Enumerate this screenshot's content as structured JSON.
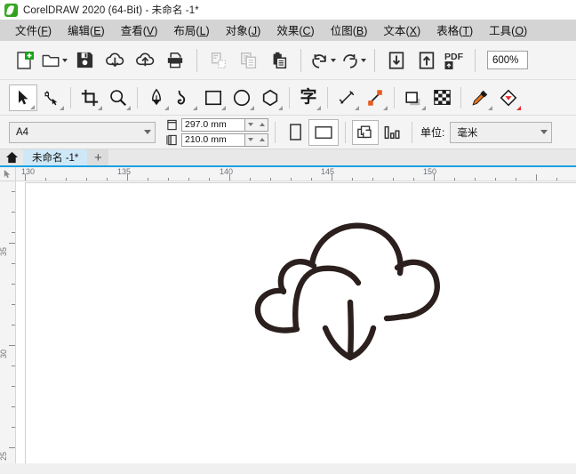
{
  "window": {
    "title": "CorelDRAW 2020 (64-Bit) - 未命名 -1*",
    "logo_icon": "coreldraw-balloon-logo"
  },
  "menubar": {
    "items": [
      {
        "name": "file",
        "label": "文件(F)",
        "cjk": "文件",
        "accel": "F"
      },
      {
        "name": "edit",
        "label": "编辑(E)",
        "cjk": "编辑",
        "accel": "E"
      },
      {
        "name": "view",
        "label": "查看(V)",
        "cjk": "查看",
        "accel": "V"
      },
      {
        "name": "layout",
        "label": "布局(L)",
        "cjk": "布局",
        "accel": "L"
      },
      {
        "name": "object",
        "label": "对象(J)",
        "cjk": "对象",
        "accel": "J"
      },
      {
        "name": "effects",
        "label": "效果(C)",
        "cjk": "效果",
        "accel": "C"
      },
      {
        "name": "bitmap",
        "label": "位图(B)",
        "cjk": "位图",
        "accel": "B"
      },
      {
        "name": "text",
        "label": "文本(X)",
        "cjk": "文本",
        "accel": "X"
      },
      {
        "name": "table",
        "label": "表格(T)",
        "cjk": "表格",
        "accel": "T"
      },
      {
        "name": "tools",
        "label": "工具(O)",
        "cjk": "工具",
        "accel": "O"
      }
    ]
  },
  "toolbar": {
    "buttons": [
      {
        "name": "new-document-button",
        "icon": "new-document-icon",
        "enabled": true,
        "dropdown": false
      },
      {
        "name": "open-document-button",
        "icon": "open-folder-icon",
        "enabled": true,
        "dropdown": true
      },
      {
        "name": "save-button",
        "icon": "floppy-save-icon",
        "enabled": true,
        "dropdown": false
      },
      {
        "name": "cloud-download-button",
        "icon": "cloud-download-icon",
        "enabled": true,
        "dropdown": false
      },
      {
        "name": "cloud-upload-button",
        "icon": "cloud-upload-icon",
        "enabled": true,
        "dropdown": false
      },
      {
        "name": "print-button",
        "icon": "printer-icon",
        "enabled": true,
        "dropdown": false
      },
      {
        "name": "cut-button",
        "icon": "scissors-cut-icon",
        "enabled": false,
        "dropdown": false
      },
      {
        "name": "copy-button",
        "icon": "copy-icon",
        "enabled": false,
        "dropdown": false
      },
      {
        "name": "paste-button",
        "icon": "paste-clipboard-icon",
        "enabled": true,
        "dropdown": false
      },
      {
        "name": "undo-button",
        "icon": "undo-arrow-icon",
        "enabled": true,
        "dropdown": true
      },
      {
        "name": "redo-button",
        "icon": "redo-arrow-icon",
        "enabled": true,
        "dropdown": true
      },
      {
        "name": "import-button",
        "icon": "import-down-arrow-icon",
        "enabled": true,
        "dropdown": false
      },
      {
        "name": "export-button",
        "icon": "export-up-arrow-icon",
        "enabled": true,
        "dropdown": false
      },
      {
        "name": "publish-pdf-button",
        "icon": "pdf-export-icon",
        "enabled": true,
        "dropdown": false
      }
    ],
    "zoom_level": "600%"
  },
  "toolbox": {
    "tools": [
      {
        "name": "tool-pick",
        "icon": "arrow-pointer-icon",
        "active": true,
        "flyout": false
      },
      {
        "name": "tool-shape",
        "icon": "shape-node-edit-icon",
        "active": false,
        "flyout": true
      },
      {
        "name": "tool-crop",
        "icon": "crop-icon",
        "active": false,
        "flyout": true
      },
      {
        "name": "tool-zoom",
        "icon": "magnifier-icon",
        "active": false,
        "flyout": true
      },
      {
        "name": "tool-freehand",
        "icon": "pen-nib-icon",
        "active": false,
        "flyout": true
      },
      {
        "name": "tool-artistic-media",
        "icon": "artistic-media-icon",
        "active": false,
        "flyout": true
      },
      {
        "name": "tool-rectangle",
        "icon": "rectangle-icon",
        "active": false,
        "flyout": true
      },
      {
        "name": "tool-ellipse",
        "icon": "ellipse-icon",
        "active": false,
        "flyout": true
      },
      {
        "name": "tool-polygon",
        "icon": "polygon-icon",
        "active": false,
        "flyout": true
      },
      {
        "name": "tool-text",
        "icon": "text-character-icon",
        "active": false,
        "flyout": true
      },
      {
        "name": "tool-dimension",
        "icon": "dimension-line-icon",
        "active": false,
        "flyout": true
      },
      {
        "name": "tool-connector",
        "icon": "connector-icon",
        "active": false,
        "flyout": true
      },
      {
        "name": "tool-drop-shadow",
        "icon": "drop-shadow-icon",
        "active": false,
        "flyout": true
      },
      {
        "name": "tool-transparency",
        "icon": "transparency-checker-icon",
        "active": false,
        "flyout": false
      },
      {
        "name": "tool-color-eyedropper",
        "icon": "eyedropper-icon",
        "active": false,
        "flyout": true
      },
      {
        "name": "tool-fill",
        "icon": "fill-color-icon",
        "active": false,
        "flyout": true
      }
    ]
  },
  "propertybar": {
    "page_size": "A4",
    "page_width": "297.0 mm",
    "page_height": "210.0 mm",
    "width_icon": "page-width-icon",
    "height_icon": "page-height-icon",
    "orientation_portrait_icon": "portrait-orientation-icon",
    "orientation_landscape_icon": "landscape-orientation-icon",
    "page_options_icon": "all-pages-icon",
    "page_guides_icon": "page-bleed-icon",
    "unit_label": "单位:",
    "unit_value": "毫米"
  },
  "tabbar": {
    "home_icon": "home-icon",
    "document_tab": "未命名 -1*",
    "add_tab_label": "+"
  },
  "rulers": {
    "horizontal": {
      "labels": [
        "130",
        "135",
        "140",
        "145",
        "150"
      ]
    },
    "vertical": {
      "labels": [
        "35",
        "30",
        "25"
      ]
    }
  },
  "canvas": {
    "artwork_name": "cloud-download-drawing",
    "stroke_color": "#2b201d",
    "background_color": "#ffffff"
  },
  "colors": {
    "accent": "#1ba1e2",
    "tab_active": "#cfe8f7",
    "menubar_bg": "#d4d4d4",
    "toolbar_bg": "#f4f4f4",
    "brand_green": "#3fae2a"
  }
}
